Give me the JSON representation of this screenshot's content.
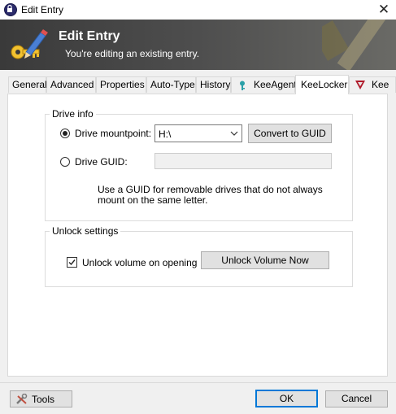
{
  "window": {
    "title": "Edit Entry",
    "close_glyph": "✕"
  },
  "banner": {
    "title": "Edit Entry",
    "subtitle": "You're editing an existing entry."
  },
  "tabs": [
    {
      "label": "General"
    },
    {
      "label": "Advanced"
    },
    {
      "label": "Properties"
    },
    {
      "label": "Auto-Type"
    },
    {
      "label": "History"
    },
    {
      "label": "KeeAgent",
      "icon": "key-icon"
    },
    {
      "label": "KeeLocker",
      "active": true
    },
    {
      "label": "Kee",
      "icon": "kee-shield-icon"
    }
  ],
  "drive_info": {
    "legend": "Drive info",
    "mountpoint_label": "Drive mountpoint:",
    "mountpoint_value": "H:\\",
    "mountpoint_selected": true,
    "convert_button": "Convert to GUID",
    "guid_label": "Drive GUID:",
    "guid_value": "",
    "help_line1": "Use a GUID for removable drives that do not always",
    "help_line2": "mount on the same letter."
  },
  "unlock_settings": {
    "legend": "Unlock settings",
    "checkbox_label": "Unlock volume on opening",
    "checked": true,
    "unlock_button": "Unlock Volume Now"
  },
  "footer": {
    "tools_label": "Tools",
    "ok_label": "OK",
    "cancel_label": "Cancel"
  },
  "colors": {
    "accent": "#0078d7",
    "banner_dark": "#3a3a3a",
    "logo_yellow": "#f2c230",
    "logo_blue": "#4a7fd4"
  }
}
